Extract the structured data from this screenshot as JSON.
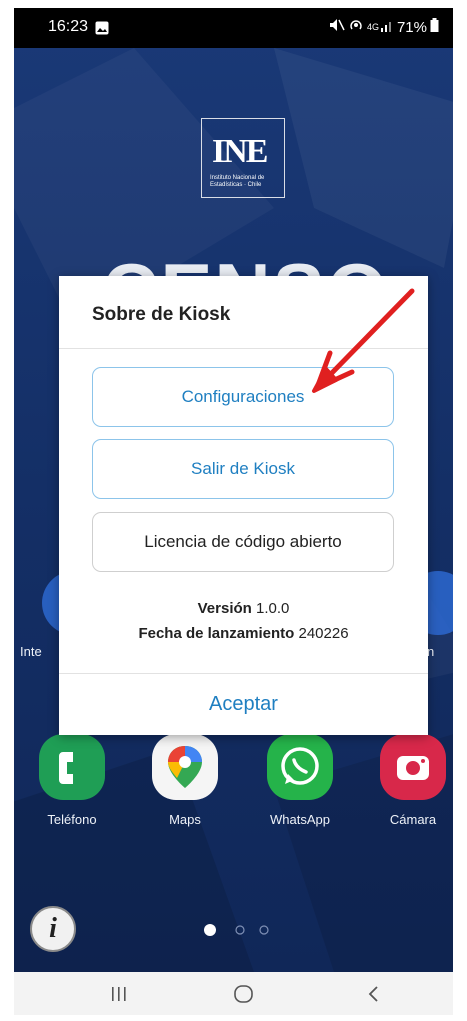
{
  "status_bar": {
    "time": "16:23",
    "network": "4G",
    "battery": "71%"
  },
  "background": {
    "logo_text": "INE",
    "logo_subtitle": "Instituto Nacional de Estadísticas · Chile",
    "banner_text": "CENSO",
    "side_label_left": "Inte",
    "side_label_right": "n"
  },
  "dialog": {
    "title": "Sobre de Kiosk",
    "buttons": {
      "settings": "Configuraciones",
      "exit": "Salir de Kiosk",
      "license": "Licencia de código abierto"
    },
    "version_label": "Versión",
    "version_value": "1.0.0",
    "release_label": "Fecha de lanzamiento",
    "release_value": "240226",
    "accept": "Aceptar"
  },
  "dock": [
    {
      "label": "Teléfono",
      "color": "#1f9e55",
      "icon": "phone-icon"
    },
    {
      "label": "Maps",
      "color": "#f5f5f5",
      "icon": "maps-pin-icon"
    },
    {
      "label": "WhatsApp",
      "color": "#25b34a",
      "icon": "whatsapp-icon"
    },
    {
      "label": "Cámara",
      "color": "#d8284a",
      "icon": "camera-icon"
    }
  ],
  "colors": {
    "accent": "#1f7fc1",
    "annotation_arrow": "#e02020",
    "wallpaper": "#14306a"
  }
}
